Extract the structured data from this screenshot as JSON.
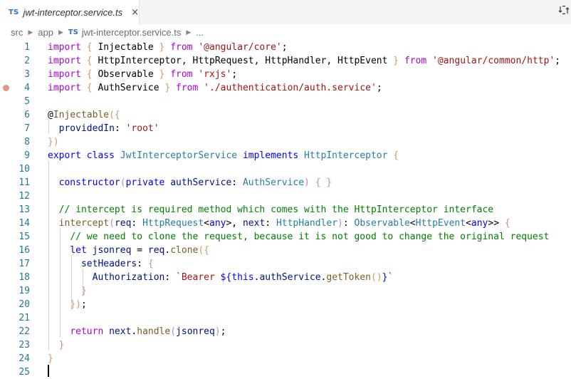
{
  "tab": {
    "lang_badge": "TS",
    "title": "jwt-interceptor.service.ts",
    "close_glyph": "×"
  },
  "toolbar": {
    "compare_icon": "compare-changes-icon"
  },
  "breadcrumb": {
    "items": [
      "src",
      "app",
      "jwt-interceptor.service.ts",
      "..."
    ],
    "file_badge": "TS"
  },
  "editor": {
    "lines": [
      {
        "n": "1",
        "tokens": [
          [
            "kc",
            "import "
          ],
          [
            "br",
            "{ "
          ],
          [
            "pl",
            "Injectable "
          ],
          [
            "br",
            "}"
          ],
          [
            "kc",
            " from "
          ],
          [
            "str",
            "'@angular/core'"
          ],
          [
            "pl",
            ";"
          ]
        ]
      },
      {
        "n": "2",
        "tokens": [
          [
            "kc",
            "import "
          ],
          [
            "br",
            "{ "
          ],
          [
            "pl",
            "HttpInterceptor, HttpRequest, HttpHandler, HttpEvent "
          ],
          [
            "br",
            "}"
          ],
          [
            "kc",
            " from "
          ],
          [
            "str",
            "'@angular/common/http'"
          ],
          [
            "pl",
            ";"
          ]
        ]
      },
      {
        "n": "3",
        "tokens": [
          [
            "kc",
            "import "
          ],
          [
            "br",
            "{ "
          ],
          [
            "pl",
            "Observable "
          ],
          [
            "br",
            "}"
          ],
          [
            "kc",
            " from "
          ],
          [
            "str",
            "'rxjs'"
          ],
          [
            "pl",
            ";"
          ]
        ]
      },
      {
        "n": "4",
        "breakpoint": true,
        "tokens": [
          [
            "kc",
            "import "
          ],
          [
            "br",
            "{ "
          ],
          [
            "pl",
            "AuthService "
          ],
          [
            "br",
            "}"
          ],
          [
            "kc",
            " from "
          ],
          [
            "str",
            "'./authentication/auth.service'"
          ],
          [
            "pl",
            ";"
          ]
        ]
      },
      {
        "n": "5",
        "tokens": []
      },
      {
        "n": "6",
        "tokens": [
          [
            "pl",
            "@"
          ],
          [
            "fn",
            "Injectable"
          ],
          [
            "br",
            "({"
          ]
        ]
      },
      {
        "n": "7",
        "tokens": [
          [
            "pl",
            "  "
          ],
          [
            "id",
            "providedIn"
          ],
          [
            "pl",
            ": "
          ],
          [
            "str",
            "'root'"
          ]
        ]
      },
      {
        "n": "8",
        "tokens": [
          [
            "br",
            "})"
          ]
        ]
      },
      {
        "n": "9",
        "tokens": [
          [
            "kw",
            "export "
          ],
          [
            "kw",
            "class "
          ],
          [
            "ty",
            "JwtInterceptorService "
          ],
          [
            "kw",
            "implements "
          ],
          [
            "ty",
            "HttpInterceptor "
          ],
          [
            "br",
            "{"
          ]
        ]
      },
      {
        "n": "10",
        "tokens": []
      },
      {
        "n": "11",
        "tokens": [
          [
            "pl",
            "  "
          ],
          [
            "kw",
            "constructor"
          ],
          [
            "br2",
            "("
          ],
          [
            "kw",
            "private "
          ],
          [
            "id",
            "authService"
          ],
          [
            "pl",
            ": "
          ],
          [
            "ty",
            "AuthService"
          ],
          [
            "br2",
            ")"
          ],
          [
            "pl",
            " "
          ],
          [
            "br2",
            "{ }"
          ]
        ]
      },
      {
        "n": "12",
        "tokens": []
      },
      {
        "n": "13",
        "tokens": [
          [
            "pl",
            "  "
          ],
          [
            "cm",
            "// intercept is required method which comes with the HttpInterceptor interface"
          ]
        ]
      },
      {
        "n": "14",
        "tokens": [
          [
            "pl",
            "  "
          ],
          [
            "fn",
            "intercept"
          ],
          [
            "br2",
            "("
          ],
          [
            "id",
            "req"
          ],
          [
            "pl",
            ": "
          ],
          [
            "ty",
            "HttpRequest"
          ],
          [
            "pl",
            "<"
          ],
          [
            "kw",
            "any"
          ],
          [
            "pl",
            ">, "
          ],
          [
            "id",
            "next"
          ],
          [
            "pl",
            ": "
          ],
          [
            "ty",
            "HttpHandler"
          ],
          [
            "br2",
            ")"
          ],
          [
            "pl",
            ": "
          ],
          [
            "ty",
            "Observable"
          ],
          [
            "pl",
            "<"
          ],
          [
            "ty",
            "HttpEvent"
          ],
          [
            "pl",
            "<"
          ],
          [
            "kw",
            "any"
          ],
          [
            "pl",
            ">> "
          ],
          [
            "br2",
            "{"
          ]
        ]
      },
      {
        "n": "15",
        "tokens": [
          [
            "pl",
            "    "
          ],
          [
            "cm",
            "// we need to clone the request, because it is not good to change the original request"
          ]
        ]
      },
      {
        "n": "16",
        "tokens": [
          [
            "pl",
            "    "
          ],
          [
            "kw",
            "let "
          ],
          [
            "id",
            "jsonreq"
          ],
          [
            "pl",
            " = "
          ],
          [
            "id",
            "req"
          ],
          [
            "pl",
            "."
          ],
          [
            "fn",
            "clone"
          ],
          [
            "br",
            "({"
          ]
        ]
      },
      {
        "n": "17",
        "tokens": [
          [
            "pl",
            "      "
          ],
          [
            "id",
            "setHeaders"
          ],
          [
            "pl",
            ": "
          ],
          [
            "br2",
            "{"
          ]
        ]
      },
      {
        "n": "18",
        "tokens": [
          [
            "pl",
            "        "
          ],
          [
            "id",
            "Authorization"
          ],
          [
            "pl",
            ": "
          ],
          [
            "str",
            "`Bearer "
          ],
          [
            "kw",
            "${"
          ],
          [
            "kw",
            "this"
          ],
          [
            "pl",
            "."
          ],
          [
            "id",
            "authService"
          ],
          [
            "pl",
            "."
          ],
          [
            "fn",
            "getToken"
          ],
          [
            "br",
            "()"
          ],
          [
            "kw",
            "}"
          ],
          [
            "str",
            "`"
          ]
        ]
      },
      {
        "n": "19",
        "tokens": [
          [
            "pl",
            "      "
          ],
          [
            "br2",
            "}"
          ]
        ]
      },
      {
        "n": "20",
        "tokens": [
          [
            "pl",
            "    "
          ],
          [
            "br",
            "})"
          ],
          [
            "pl",
            ";"
          ]
        ]
      },
      {
        "n": "21",
        "tokens": []
      },
      {
        "n": "22",
        "tokens": [
          [
            "pl",
            "    "
          ],
          [
            "kc",
            "return "
          ],
          [
            "id",
            "next"
          ],
          [
            "pl",
            "."
          ],
          [
            "fn",
            "handle"
          ],
          [
            "br2",
            "("
          ],
          [
            "id",
            "jsonreq"
          ],
          [
            "br2",
            ")"
          ],
          [
            "pl",
            ";"
          ]
        ]
      },
      {
        "n": "23",
        "tokens": [
          [
            "pl",
            "  "
          ],
          [
            "br2",
            "}"
          ]
        ]
      },
      {
        "n": "24",
        "tokens": [
          [
            "br",
            "}"
          ]
        ]
      },
      {
        "n": "25",
        "tokens": []
      }
    ]
  }
}
